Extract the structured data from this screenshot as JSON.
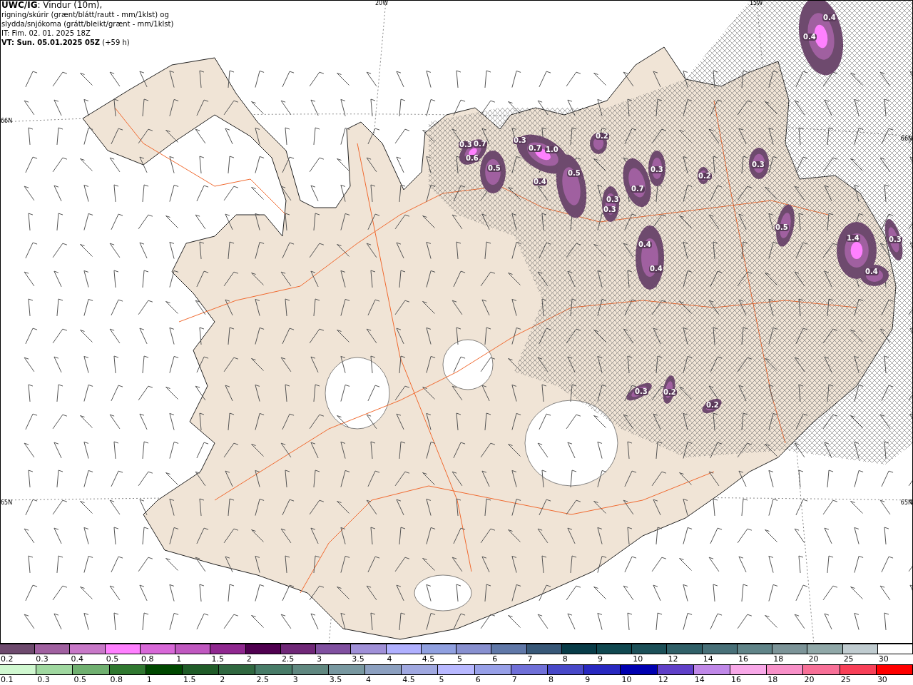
{
  "caption_lines": [
    "**UWC/IG**: Vindur (10m),",
    "rigning/skúrir (grænt/blátt/rautt - mm/1klst) og",
    "slydda/snjókoma (grátt/bleikt/grænt - mm/1klst)",
    "IT: Fim. 02. 01. 2025 18Z",
    "**VT: Sun. 05.01.2025 05Z** (+59 h)"
  ],
  "grid_labels": {
    "top": [
      "20W",
      "15W"
    ],
    "left": [
      "66N",
      "65N"
    ],
    "right": [
      "66N",
      "65N"
    ]
  },
  "precip_labels": [
    "0.4",
    "0.4",
    "0.3",
    "0.7",
    "0.6",
    "0.5",
    "0.3",
    "0.7",
    "1.0",
    "0.5",
    "0.4",
    "0.2",
    "0.3",
    "0.3",
    "0.7",
    "0.3",
    "0.4",
    "0.4",
    "0.2",
    "0.3",
    "0.5",
    "1.4",
    "0.4",
    "0.3",
    "0.3",
    "0.2",
    "0.2"
  ],
  "legend": {
    "snow": [
      {
        "label": "0.2",
        "color": "#6e4a6e"
      },
      {
        "label": "0.3",
        "color": "#a060a0"
      },
      {
        "label": "0.4",
        "color": "#c878c8"
      },
      {
        "label": "0.5",
        "color": "#ff80ff"
      },
      {
        "label": "0.8",
        "color": "#d868d8"
      },
      {
        "label": "1",
        "color": "#c058c0"
      },
      {
        "label": "1.5",
        "color": "#902890"
      },
      {
        "label": "2",
        "color": "#500050"
      },
      {
        "label": "2.5",
        "color": "#702878"
      },
      {
        "label": "3",
        "color": "#8050a0"
      },
      {
        "label": "3.5",
        "color": "#a090d8"
      },
      {
        "label": "4",
        "color": "#b0b0ff"
      },
      {
        "label": "4.5",
        "color": "#90a0e0"
      },
      {
        "label": "5",
        "color": "#8890d0"
      },
      {
        "label": "6",
        "color": "#6078a8"
      },
      {
        "label": "7",
        "color": "#385878"
      },
      {
        "label": "8",
        "color": "#083c48"
      },
      {
        "label": "9",
        "color": "#104850"
      },
      {
        "label": "10",
        "color": "#1c5058"
      },
      {
        "label": "12",
        "color": "#306068"
      },
      {
        "label": "14",
        "color": "#487078"
      },
      {
        "label": "16",
        "color": "#608488"
      },
      {
        "label": "18",
        "color": "#7c9498"
      },
      {
        "label": "20",
        "color": "#90a8a8"
      },
      {
        "label": "25",
        "color": "#c0ccd0"
      },
      {
        "label": "30",
        "color": "#ffffff"
      }
    ],
    "rain": [
      {
        "label": "0.1",
        "color": "#d0f8d0"
      },
      {
        "label": "0.3",
        "color": "#a0d8a0"
      },
      {
        "label": "0.5",
        "color": "#70b070"
      },
      {
        "label": "0.8",
        "color": "#307830"
      },
      {
        "label": "1",
        "color": "#004800"
      },
      {
        "label": "1.5",
        "color": "#205c28"
      },
      {
        "label": "2",
        "color": "#306840"
      },
      {
        "label": "2.5",
        "color": "#487c68"
      },
      {
        "label": "3",
        "color": "#608880"
      },
      {
        "label": "3.5",
        "color": "#7898a0"
      },
      {
        "label": "4",
        "color": "#8ca0c0"
      },
      {
        "label": "4.5",
        "color": "#a0a8e0"
      },
      {
        "label": "5",
        "color": "#b8b8ff"
      },
      {
        "label": "6",
        "color": "#98a0e8"
      },
      {
        "label": "7",
        "color": "#7070d8"
      },
      {
        "label": "8",
        "color": "#4848c8"
      },
      {
        "label": "9",
        "color": "#2828c0"
      },
      {
        "label": "10",
        "color": "#0000b0"
      },
      {
        "label": "12",
        "color": "#6040c8"
      },
      {
        "label": "14",
        "color": "#c088e8"
      },
      {
        "label": "16",
        "color": "#f8a8e8"
      },
      {
        "label": "18",
        "color": "#f890c8"
      },
      {
        "label": "20",
        "color": "#f87098"
      },
      {
        "label": "25",
        "color": "#f84058"
      },
      {
        "label": "30",
        "color": "#ff0000"
      }
    ]
  }
}
